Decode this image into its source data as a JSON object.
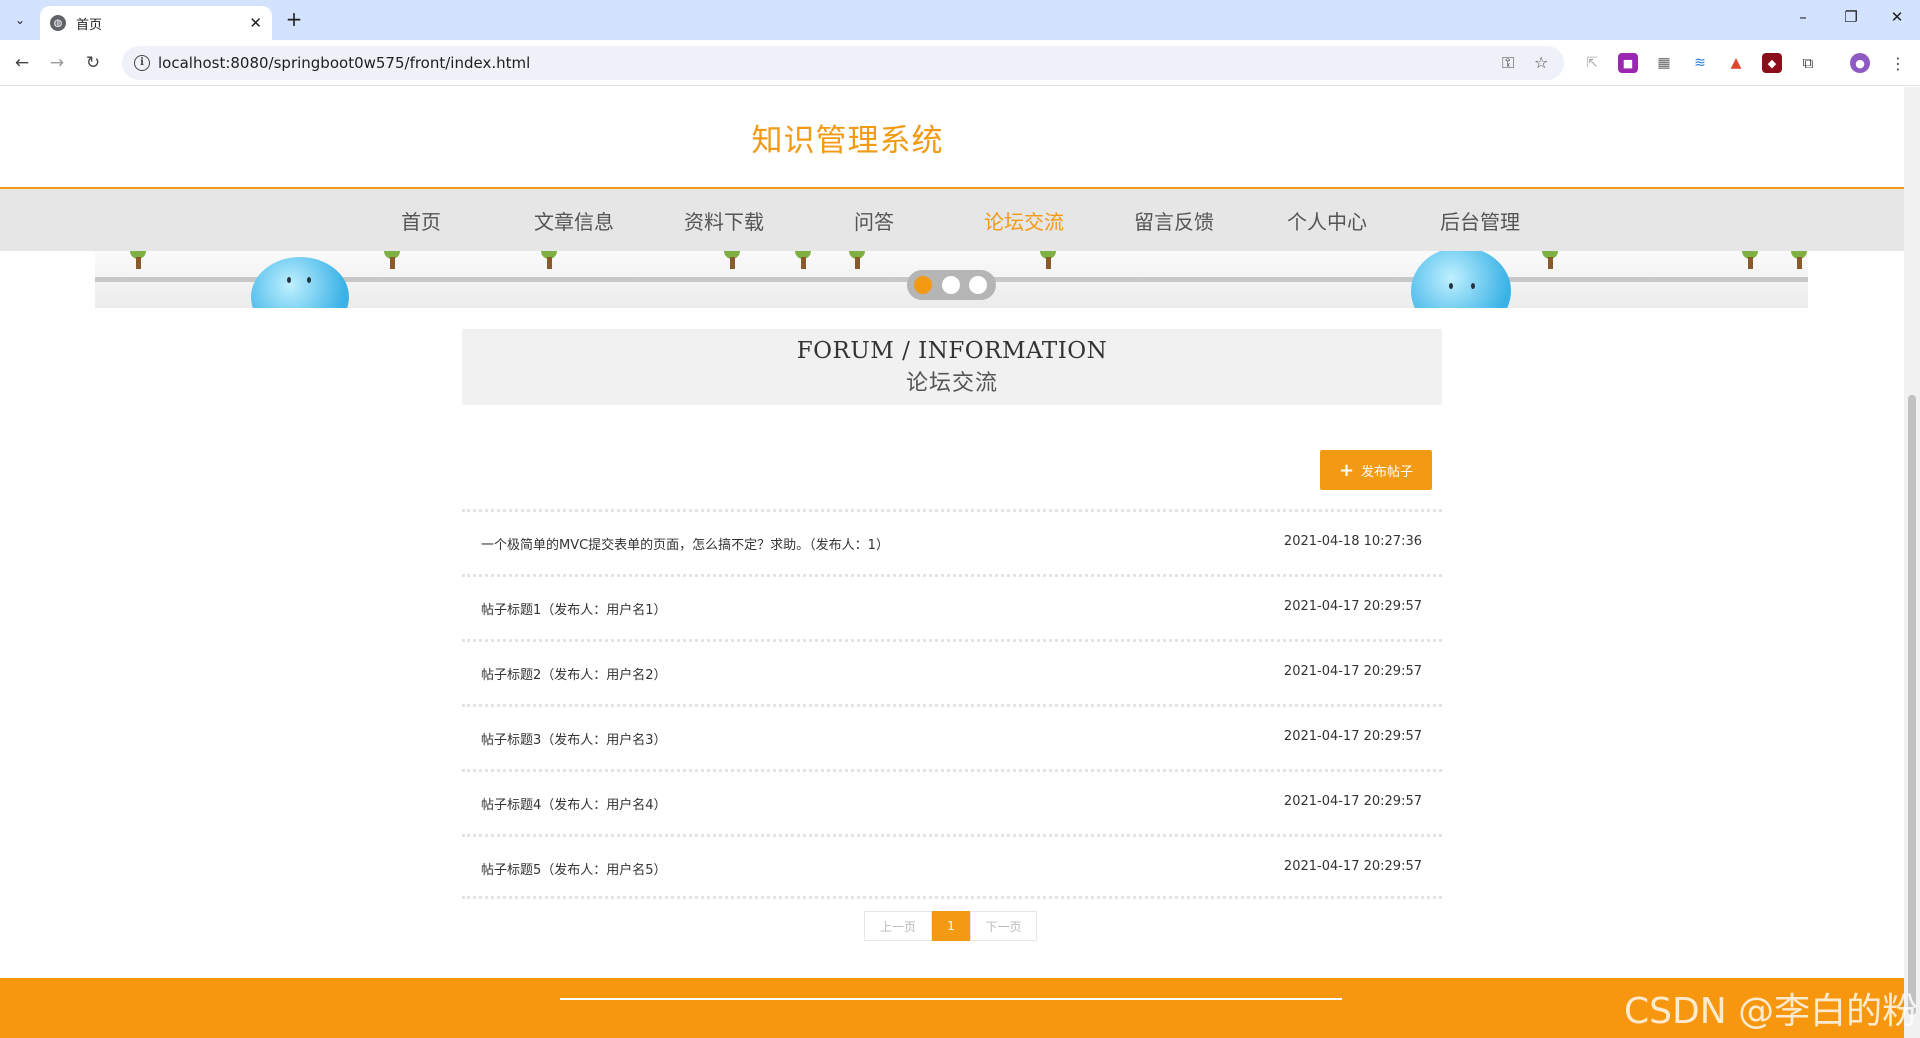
{
  "browser": {
    "tab_title": "首页",
    "url": "localhost:8080/springboot0w575/front/index.html"
  },
  "site": {
    "title": "知识管理系统",
    "nav": [
      {
        "label": "首页",
        "active": false
      },
      {
        "label": "文章信息",
        "active": false
      },
      {
        "label": "资料下载",
        "active": false
      },
      {
        "label": "问答",
        "active": false
      },
      {
        "label": "论坛交流",
        "active": true
      },
      {
        "label": "留言反馈",
        "active": false
      },
      {
        "label": "个人中心",
        "active": false
      },
      {
        "label": "后台管理",
        "active": false
      }
    ]
  },
  "carousel": {
    "slides": 3,
    "active_index": 0
  },
  "section": {
    "title_en": "FORUM / INFORMATION",
    "title_cn": "论坛交流"
  },
  "actions": {
    "post_button": "发布帖子"
  },
  "posts": [
    {
      "title": "一个极简单的MVC提交表单的页面，怎么搞不定？求助。（发布人：1）",
      "time": "2021-04-18 10:27:36"
    },
    {
      "title": "帖子标题1（发布人：用户名1）",
      "time": "2021-04-17 20:29:57"
    },
    {
      "title": "帖子标题2（发布人：用户名2）",
      "time": "2021-04-17 20:29:57"
    },
    {
      "title": "帖子标题3（发布人：用户名3）",
      "time": "2021-04-17 20:29:57"
    },
    {
      "title": "帖子标题4（发布人：用户名4）",
      "time": "2021-04-17 20:29:57"
    },
    {
      "title": "帖子标题5（发布人：用户名5）",
      "time": "2021-04-17 20:29:57"
    }
  ],
  "pagination": {
    "prev": "上一页",
    "current": "1",
    "next": "下一页"
  },
  "watermark": "CSDN @李白的粉",
  "colors": {
    "accent": "#f39a14",
    "footer": "#f7970f"
  }
}
